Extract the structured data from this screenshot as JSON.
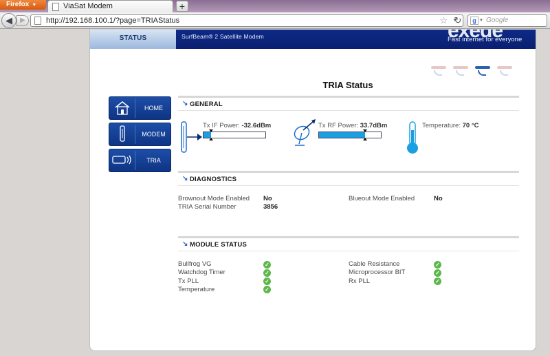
{
  "browser": {
    "menu_button": "Firefox",
    "tab_title": "ViaSat Modem",
    "new_tab": "+",
    "url": "http://192.168.100.1/?page=TRIAStatus",
    "search_placeholder": "Google"
  },
  "banner": {
    "status_tab": "STATUS",
    "product": "SurfBeam® 2 Satellite Modem",
    "brand": "exede",
    "tagline": "Fast internet for everyone"
  },
  "page": {
    "title": "TRIA Status"
  },
  "nav": [
    {
      "label": "HOME",
      "icon": "home-icon"
    },
    {
      "label": "MODEM",
      "icon": "modem-icon"
    },
    {
      "label": "TRIA",
      "icon": "tria-icon"
    }
  ],
  "general": {
    "title": "GENERAL",
    "tx_if": {
      "label": "Tx IF Power:",
      "value": "-32.6dBm",
      "fill_pct": 12
    },
    "tx_rf": {
      "label": "Tx RF Power:",
      "value": "33.7dBm",
      "fill_pct": 74
    },
    "temperature": {
      "label": "Temperature:",
      "value": "70 °C"
    }
  },
  "diagnostics": {
    "title": "DIAGNOSTICS",
    "rows": [
      {
        "label": "Brownout Mode Enabled",
        "value": "No"
      },
      {
        "label": "TRIA Serial Number",
        "value": "3856"
      },
      {
        "label": "Blueout Mode Enabled",
        "value": "No"
      }
    ]
  },
  "module_status": {
    "title": "MODULE STATUS",
    "left": [
      "Bullfrog VG",
      "Watchdog Timer",
      "Tx PLL",
      "Temperature"
    ],
    "right": [
      "Cable Resistance",
      "Microprocessor BIT",
      "Rx PLL"
    ],
    "status_glyph": "✓",
    "status_color": "#5cb84a"
  },
  "colors": {
    "banner": "#0e2a86",
    "accent": "#1c9ee2",
    "nav_button": "#1d4ea8"
  }
}
